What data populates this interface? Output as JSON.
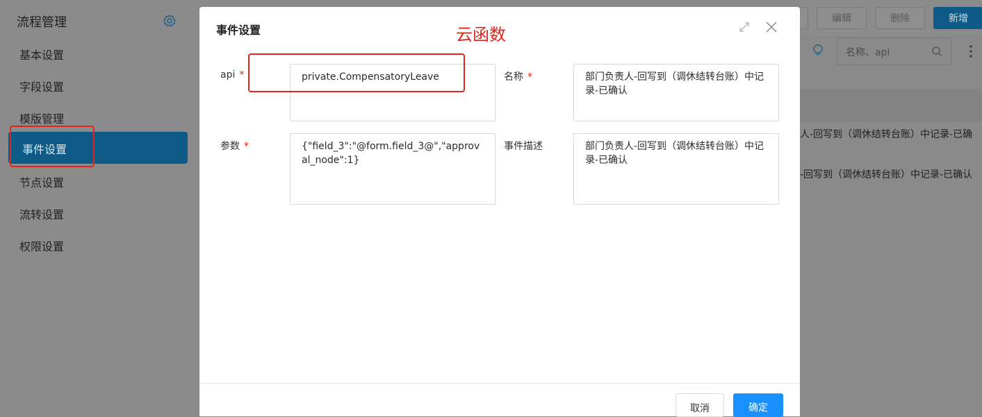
{
  "sidebar": {
    "title": "流程管理",
    "items": [
      {
        "label": "基本设置"
      },
      {
        "label": "字段设置"
      },
      {
        "label": "模版管理"
      },
      {
        "label": "事件设置"
      },
      {
        "label": "节点设置"
      },
      {
        "label": "流转设置"
      },
      {
        "label": "权限设置"
      }
    ]
  },
  "background": {
    "buttons": {
      "edit": "编辑",
      "delete": "删除",
      "add": "新增"
    },
    "search_placeholder": "名称、api",
    "rows": [
      "人-回写到（调休结转台账）中记录-已确",
      "-回写到（调休结转台账）中记录-已确认"
    ]
  },
  "modal": {
    "title": "事件设置",
    "annotation": "云函数",
    "fields": {
      "api": {
        "label": "api",
        "value": "private.CompensatoryLeave"
      },
      "name": {
        "label": "名称",
        "value": "部门负责人-回写到（调休结转台账）中记录-已确认"
      },
      "params": {
        "label": "参数",
        "value": "{\"field_3\":\"@form.field_3@\",\"approval_node\":1}"
      },
      "desc": {
        "label": "事件描述",
        "value": "部门负责人-回写到（调休结转台账）中记录-已确认"
      }
    },
    "required_mark": "*",
    "cancel_label": "取消",
    "ok_label": "确定"
  },
  "colors": {
    "accent": "#0e5a86",
    "primary_button": "#1890ff",
    "annotation_red": "#e3241b"
  }
}
